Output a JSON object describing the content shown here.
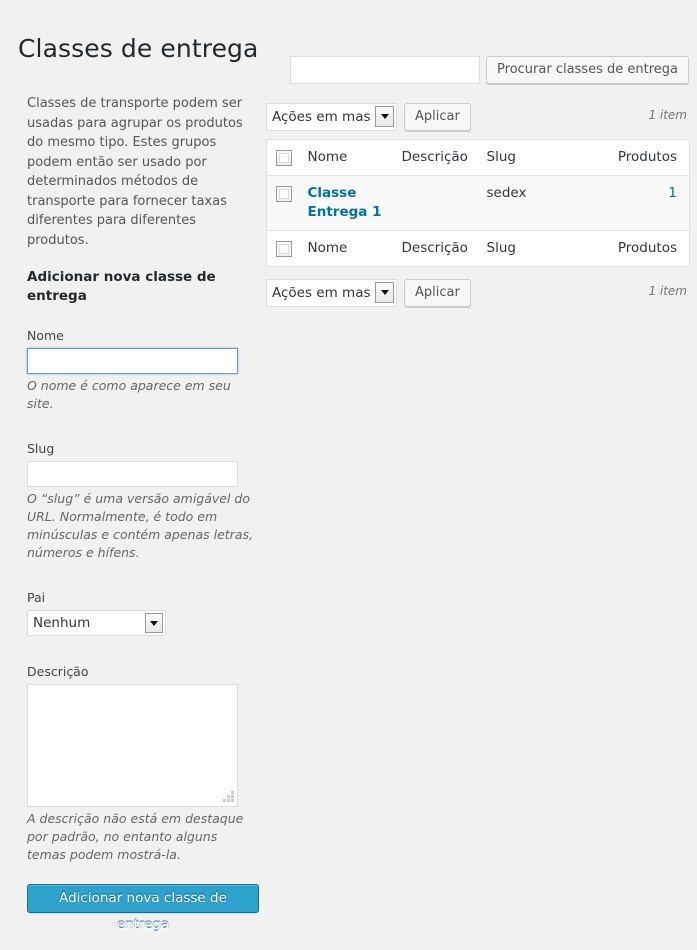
{
  "page": {
    "title": "Classes de entrega",
    "background_color": "#f1f1f1",
    "accent_color": "#2ea2cc",
    "link_color": "#0073aa"
  },
  "sidebar": {
    "intro_text": "Classes de transporte podem ser usadas para agrupar os produtos do mesmo tipo. Estes grupos podem então ser usado por determinados métodos de transporte para fornecer taxas diferentes para diferentes produtos.",
    "form_heading": "Adicionar nova classe de entrega",
    "fields": {
      "name": {
        "label": "Nome",
        "value": "",
        "placeholder": "",
        "help": "O nome é como aparece em seu site."
      },
      "slug": {
        "label": "Slug",
        "value": "",
        "placeholder": "",
        "help": "O “slug” é uma versão amigável do URL. Normalmente, é todo em minúsculas e contém apenas letras, números e hífens."
      },
      "parent": {
        "label": "Pai",
        "selected": "Nenhum",
        "options": [
          "Nenhum"
        ]
      },
      "description": {
        "label": "Descrição",
        "value": "",
        "placeholder": "",
        "help": "A descrição não está em destaque por padrão, no entanto alguns temas podem mostrá-la."
      }
    },
    "submit_label": "Adicionar nova classe de entrega"
  },
  "main": {
    "search": {
      "value": "",
      "placeholder": "",
      "button_label": "Procurar classes de entrega"
    },
    "tablenav_top": {
      "bulk_selected": "Ações em massa",
      "bulk_options": [
        "Ações em massa"
      ],
      "apply_label": "Aplicar",
      "item_count": "1 item"
    },
    "tablenav_bottom": {
      "bulk_selected": "Ações em massa",
      "bulk_options": [
        "Ações em massa"
      ],
      "apply_label": "Aplicar",
      "item_count": "1 item"
    },
    "table": {
      "columns": [
        "Nome",
        "Descrição",
        "Slug",
        "Produtos"
      ],
      "rows": [
        {
          "name": "Classe Entrega 1",
          "description": "",
          "slug": "sedex",
          "products": "1"
        }
      ]
    }
  }
}
